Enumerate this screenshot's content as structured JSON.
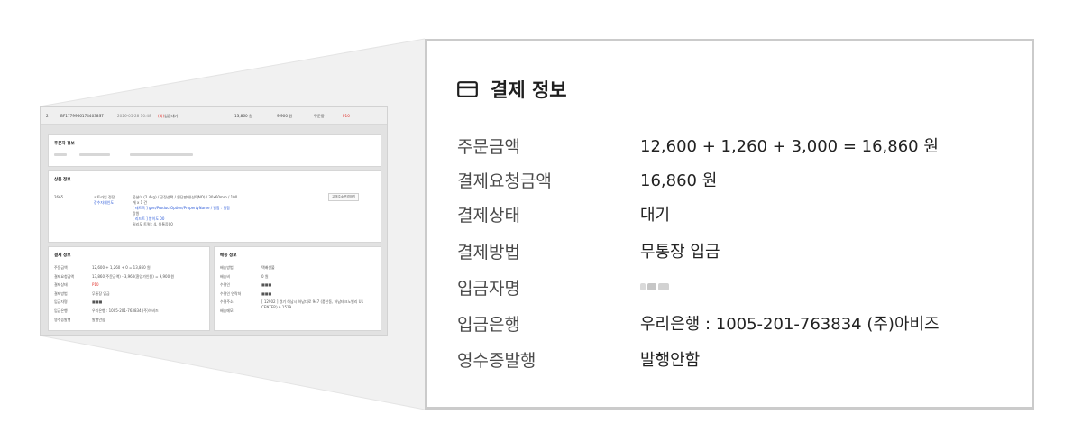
{
  "mini": {
    "row": {
      "index": "2",
      "order_no": "BF17799661744038S7",
      "date": "2026-05-28 10:48",
      "status_tag": "입금대기",
      "status_label": "(회)",
      "price1": "13,860 원",
      "price2": "9,900 원",
      "state": "주문중",
      "state2": "P10"
    },
    "orderer": {
      "title": "주문자 정보"
    },
    "product": {
      "title": "상품 정보",
      "code": "2665",
      "name_line1": "코트라임 정장",
      "name_line2": "장수자체인도",
      "opt1": "옵션이 (2.4kg) / 공정선택 / 원단판매(선택NO) / 30x60mm / 100",
      "opt2": "개 x 1 건",
      "opt3": "[ 레트폭 ] gen/ProductOption/PropertyName / 빨함 : 밀함",
      "opt4": "강원",
      "opt5": "[ 리드트 ] 밤이도 00",
      "opt6": "밀리도 트럴 : 4, 원통증00",
      "button": "고객주소변경하기"
    },
    "payment": {
      "title": "결제 정보",
      "rows": [
        [
          "주문금액",
          "12,600 + 1,260 + 0 = 13,860 원"
        ],
        [
          "결제요청금액",
          "13,860(주문금액) - 3,960(환입가인원) = 9,900 원"
        ],
        [
          "결제상태",
          "P10"
        ],
        [
          "결제방법",
          "무통장 입금"
        ],
        [
          "입금자명",
          "■■■"
        ],
        [
          "입금은행",
          "우리은행 : 1005-201-763834 (주)아비즈"
        ],
        [
          "영수증발행",
          "발행안함"
        ]
      ]
    },
    "delivery": {
      "title": "배송 정보",
      "rows": [
        [
          "배송방법",
          "택배선불"
        ],
        [
          "배송비",
          "0 원"
        ],
        [
          "수령인",
          "■■■"
        ],
        [
          "수령인 연락처",
          "■■■"
        ],
        [
          "수령주소",
          "[ 12902 ] 경기 하남시 하남대로 947 (풍산동, 하남테크노밸리 U1 CENTER) A 1519"
        ],
        [
          "배송메모",
          ""
        ]
      ]
    }
  },
  "panel": {
    "title": "결제 정보",
    "icon": "credit-card-icon",
    "rows": [
      {
        "label": "주문금액",
        "value": "12,600 + 1,260 + 3,000 = 16,860 원"
      },
      {
        "label": "결제요청금액",
        "value": "16,860 원"
      },
      {
        "label": "결제상태",
        "value": "대기"
      },
      {
        "label": "결제방법",
        "value": "무통장 입금"
      },
      {
        "label": "입금자명",
        "value": ""
      },
      {
        "label": "입금은행",
        "value": "우리은행 : 1005-201-763834 (주)아비즈"
      },
      {
        "label": "영수증발행",
        "value": "발행안함"
      }
    ]
  },
  "colors": {
    "panel_border": "#cbcbcb",
    "page_bg": "#e2e2e2",
    "accent_red": "#e0302a",
    "accent_blue": "#2a59d8"
  }
}
